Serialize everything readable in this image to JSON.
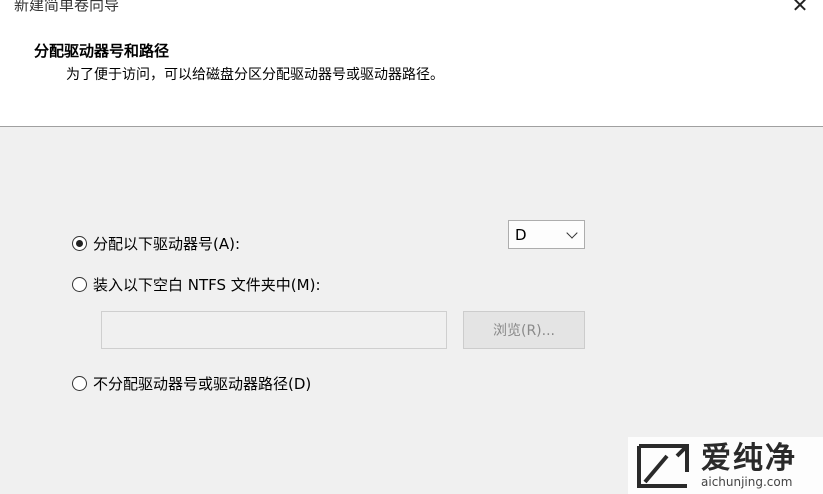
{
  "window": {
    "title": "新建简单卷向导",
    "close_glyph": "✕"
  },
  "header": {
    "title": "分配驱动器号和路径",
    "description": "为了便于访问，可以给磁盘分区分配驱动器号或驱动器路径。"
  },
  "options": {
    "assign_letter": {
      "label": "分配以下驱动器号(A):",
      "checked": true
    },
    "mount_folder": {
      "label": "装入以下空白 NTFS 文件夹中(M):",
      "checked": false
    },
    "no_assign": {
      "label": "不分配驱动器号或驱动器路径(D)",
      "checked": false
    }
  },
  "drive_select": {
    "value": "D"
  },
  "folder_path": {
    "value": "",
    "enabled": false
  },
  "browse_button": {
    "label": "浏览(R)...",
    "enabled": false
  },
  "watermark": {
    "brand": "爱纯净",
    "site": "aichunjing.com"
  }
}
